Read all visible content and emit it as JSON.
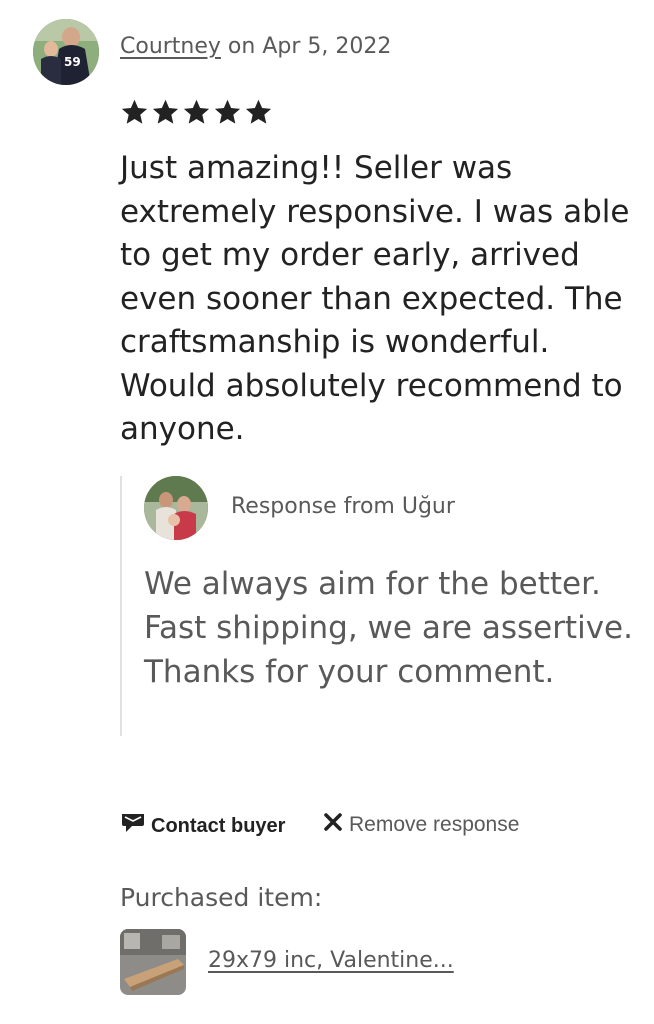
{
  "review": {
    "reviewer_name": "Courtney",
    "date_text": " on Apr 5, 2022",
    "rating": 5,
    "rating_max": 5,
    "text": "Just amazing!! Seller was extremely responsive. I was able to get my order early, arrived even sooner than expected. The craftsmanship is wonderful. Would absolutely recommend to anyone."
  },
  "response": {
    "header": "Response from Uğur",
    "text": "We always aim for the better. Fast shipping, we are assertive. Thanks for your comment."
  },
  "actions": {
    "contact_label": "Contact buyer",
    "contact_icon": "megaphone-icon",
    "remove_label": "Remove response",
    "remove_icon": "x-icon"
  },
  "purchase": {
    "label": "Purchased item:",
    "item_title": "29x79 inc, Valentine..."
  },
  "colors": {
    "primary_text": "#222222",
    "secondary_text": "#595959",
    "divider": "#e1e1e1"
  }
}
